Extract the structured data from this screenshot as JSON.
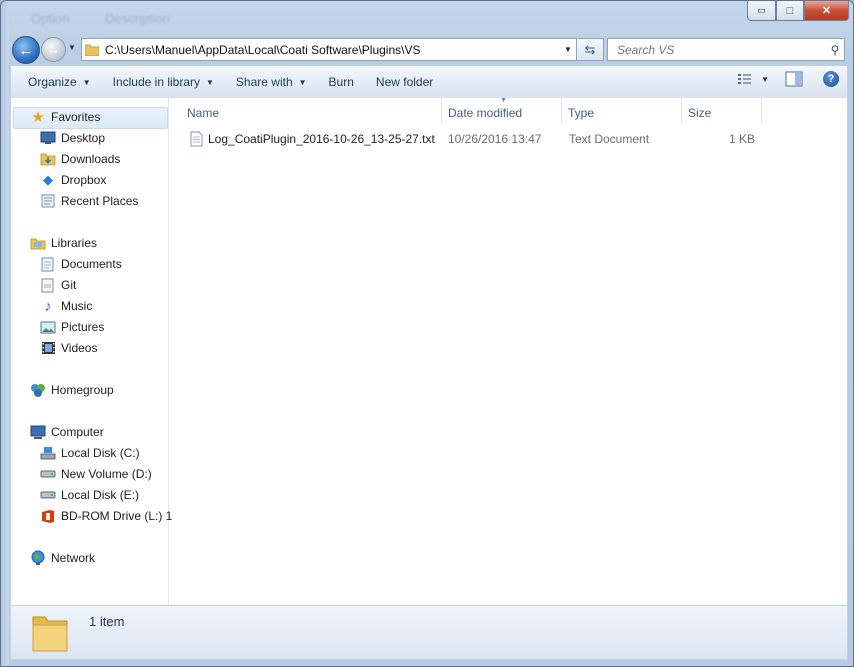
{
  "window": {
    "background_titles": [
      "Option",
      "Description"
    ],
    "caption": {
      "minimize": "▭",
      "maximize": "□",
      "close": "✕"
    }
  },
  "address_bar": {
    "path": "C:\\Users\\Manuel\\AppData\\Local\\Coati Software\\Plugins\\VS",
    "search_placeholder": "Search VS"
  },
  "toolbar": {
    "organize": "Organize",
    "include_in_library": "Include in library",
    "share_with": "Share with",
    "burn": "Burn",
    "new_folder": "New folder"
  },
  "sidebar": {
    "favorites": {
      "label": "Favorites",
      "items": [
        "Desktop",
        "Downloads",
        "Dropbox",
        "Recent Places"
      ]
    },
    "libraries": {
      "label": "Libraries",
      "items": [
        "Documents",
        "Git",
        "Music",
        "Pictures",
        "Videos"
      ]
    },
    "homegroup": {
      "label": "Homegroup"
    },
    "computer": {
      "label": "Computer",
      "items": [
        "Local Disk (C:)",
        "New Volume (D:)",
        "Local Disk (E:)",
        "BD-ROM Drive (L:) 1"
      ]
    },
    "network": {
      "label": "Network"
    }
  },
  "columns": [
    "Name",
    "Date modified",
    "Type",
    "Size"
  ],
  "files": [
    {
      "name": "Log_CoatiPlugin_2016-10-26_13-25-27.txt",
      "date": "10/26/2016 13:47",
      "type": "Text Document",
      "size": "1 KB"
    }
  ],
  "status": {
    "count": "1 item"
  },
  "colors": {
    "accent": "#2e6fbf",
    "office_red": "#d83b01"
  }
}
